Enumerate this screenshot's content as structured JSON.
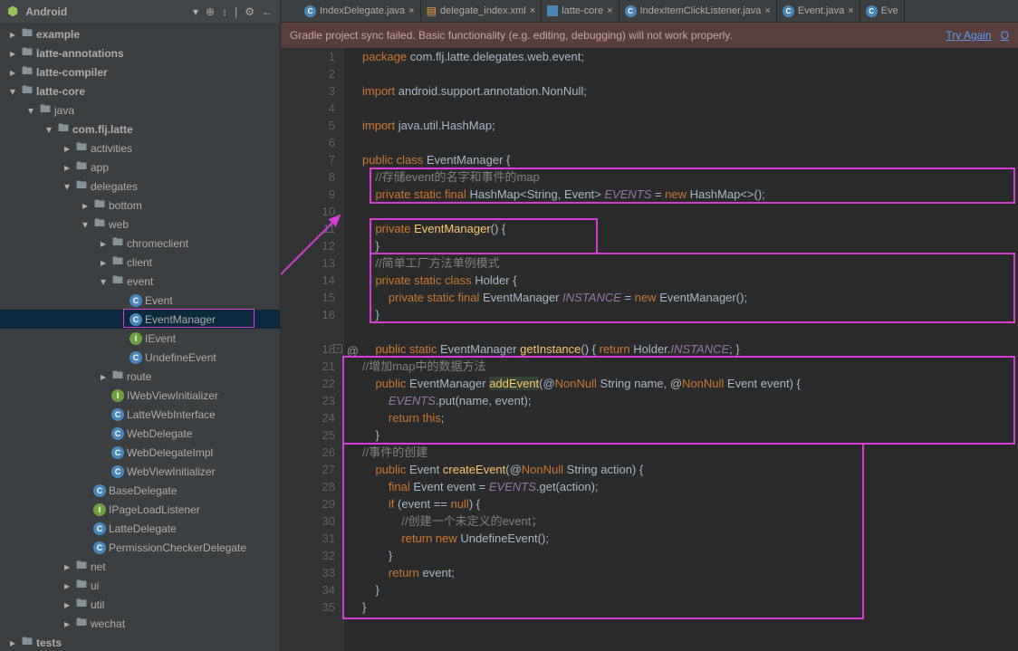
{
  "sidebar": {
    "title": "Android",
    "tree": {
      "example": "example",
      "latte_annotations": "latte-annotations",
      "latte_compiler": "latte-compiler",
      "latte_core": "latte-core",
      "java": "java",
      "pkg": "com.flj.latte",
      "activities": "activities",
      "app": "app",
      "delegates": "delegates",
      "bottom": "bottom",
      "web": "web",
      "chromeclient": "chromeclient",
      "client": "client",
      "event": "event",
      "Event": "Event",
      "EventManager": "EventManager",
      "IEvent": "IEvent",
      "UndefineEvent": "UndefineEvent",
      "route": "route",
      "IWebViewInitializer": "IWebViewInitializer",
      "LatteWebInterface": "LatteWebInterface",
      "WebDelegate": "WebDelegate",
      "WebDelegateImpl": "WebDelegateImpl",
      "WebViewInitializer": "WebViewInitializer",
      "BaseDelegate": "BaseDelegate",
      "IPageLoadListener": "IPageLoadListener",
      "LatteDelegate": "LatteDelegate",
      "PermissionCheckerDelegate": "PermissionCheckerDelegate",
      "net": "net",
      "ui": "ui",
      "util": "util",
      "wechat": "wechat",
      "tests": "tests"
    }
  },
  "tabs": {
    "t1": "IndexDelegate.java",
    "t2": "delegate_index.xml",
    "t3": "latte-core",
    "t4": "IndexItemClickListener.java",
    "t5": "Event.java",
    "t6": "Eve"
  },
  "sync": {
    "msg": "Gradle project sync failed. Basic functionality (e.g. editing, debugging) will not work properly.",
    "tryAgain": "Try Again",
    "openMsg": "O"
  },
  "code": {
    "l1_kw": "package",
    "l1_pkg": " com.flj.latte.delegates.web.event;",
    "l3_kw": "import",
    "l3_pkg": " android.support.annotation.NonNull;",
    "l5_kw": "import",
    "l5_pkg": " java.util.HashMap;",
    "l7_1": "public class ",
    "l7_2": "EventManager ",
    "l7_3": "{",
    "l8_c": "//存储event的名字和事件的map",
    "l9_1": "private static final ",
    "l9_2": "HashMap<String, Event> ",
    "l9_3": "EVENTS",
    "l9_4": " = ",
    "l9_5": "new ",
    "l9_6": "HashMap<>();",
    "l11_1": "private ",
    "l11_2": "EventManager",
    "l11_3": "() {",
    "l12": "}",
    "l13_c": "//简单工厂方法单例模式",
    "l14_1": "private static class ",
    "l14_2": "Holder ",
    "l14_3": "{",
    "l15_1": "private static final ",
    "l15_2": "EventManager ",
    "l15_3": "INSTANCE",
    "l15_4": " = ",
    "l15_5": "new ",
    "l15_6": "EventManager();",
    "l16": "}",
    "l18_1": "public static ",
    "l18_2": "EventManager ",
    "l18_3": "getInstance",
    "l18_4": "() { ",
    "l18_5": "return ",
    "l18_6": "Holder.",
    "l18_7": "INSTANCE",
    "l18_8": "; }",
    "l21_c": "//增加map中的数据方法",
    "l22_1": "public ",
    "l22_2": "EventManager ",
    "l22_3": "addEvent",
    "l22_4": "(@",
    "l22_5": "NonNull",
    "l22_6": " String name, @",
    "l22_7": "NonNull",
    "l22_8": " Event event) {",
    "l23_1": "EVENTS",
    "l23_2": ".put(name, event);",
    "l24_1": "return this",
    "l24_2": ";",
    "l25": "}",
    "l26_c": "//事件的创建",
    "l27_1": "public ",
    "l27_2": "Event ",
    "l27_3": "createEvent",
    "l27_4": "(@",
    "l27_5": "NonNull",
    "l27_6": " String action) {",
    "l28_1": "final ",
    "l28_2": "Event event = ",
    "l28_3": "EVENTS",
    "l28_4": ".get(action);",
    "l29_1": "if ",
    "l29_2": "(event == ",
    "l29_3": "null",
    "l29_4": ") {",
    "l30_c": "//创建一个未定义的event；",
    "l31_1": "return new ",
    "l31_2": "UndefineEvent();",
    "l32": "}",
    "l33_1": "return ",
    "l33_2": "event;",
    "l34": "}",
    "l35": "}"
  },
  "lineNumbers": [
    "1",
    "2",
    "3",
    "4",
    "5",
    "6",
    "7",
    "8",
    "9",
    "10",
    "11",
    "12",
    "13",
    "14",
    "15",
    "16",
    "",
    "18",
    "21",
    "22",
    "23",
    "24",
    "25",
    "26",
    "27",
    "28",
    "29",
    "30",
    "31",
    "32",
    "33",
    "34",
    "35"
  ]
}
